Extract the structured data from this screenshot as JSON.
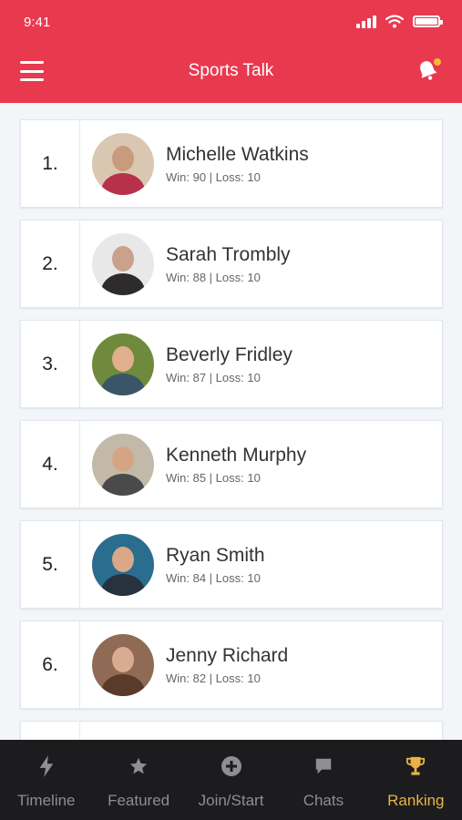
{
  "status": {
    "time": "9:41"
  },
  "header": {
    "title": "Sports Talk"
  },
  "rankings": [
    {
      "rank": "1.",
      "name": "Michelle Watkins",
      "stats": "Win: 90 | Loss: 10",
      "bg": "#d9c7b2",
      "skin": "#c99a7c",
      "shirt": "#b7314a"
    },
    {
      "rank": "2.",
      "name": "Sarah Trombly",
      "stats": "Win: 88 | Loss: 10",
      "bg": "#e8e8e8",
      "skin": "#caa18a",
      "shirt": "#2e2b2b"
    },
    {
      "rank": "3.",
      "name": "Beverly Fridley",
      "stats": "Win: 87 | Loss: 10",
      "bg": "#6f8a3c",
      "skin": "#e0b08e",
      "shirt": "#3a5468"
    },
    {
      "rank": "4.",
      "name": "Kenneth Murphy",
      "stats": "Win: 85 | Loss: 10",
      "bg": "#c3b9a8",
      "skin": "#d4a584",
      "shirt": "#4a4a4a"
    },
    {
      "rank": "5.",
      "name": "Ryan Smith",
      "stats": "Win: 84 | Loss: 10",
      "bg": "#2a6d8f",
      "skin": "#d9a987",
      "shirt": "#26323e"
    },
    {
      "rank": "6.",
      "name": "Jenny Richard",
      "stats": "Win: 82 | Loss: 10",
      "bg": "#8f6a55",
      "skin": "#d9ab90",
      "shirt": "#5a3a2a"
    }
  ],
  "tabs": [
    {
      "label": "Timeline",
      "icon": "lightning-icon"
    },
    {
      "label": "Featured",
      "icon": "star-icon"
    },
    {
      "label": "Join/Start",
      "icon": "plus-circle-icon"
    },
    {
      "label": "Chats",
      "icon": "chat-icon"
    },
    {
      "label": "Ranking",
      "icon": "trophy-icon",
      "active": true
    }
  ],
  "colors": {
    "brand": "#e8394f",
    "active_tab": "#e8b445",
    "tabbar": "#1c1c1e",
    "notification_dot": "#f7b733"
  }
}
